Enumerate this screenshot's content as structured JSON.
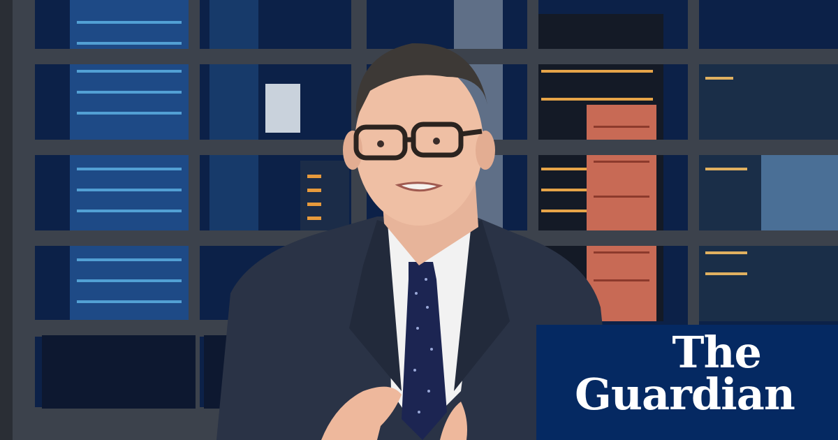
{
  "logo": {
    "line1": "The",
    "line2": "Guardian",
    "background": "#052962",
    "text_color": "#ffffff"
  },
  "scene": {
    "sky_color": "#0d2a55",
    "window_frame_color": "#3a3f48",
    "suit_color": "#2a3346",
    "tie_color": "#1a2450"
  }
}
